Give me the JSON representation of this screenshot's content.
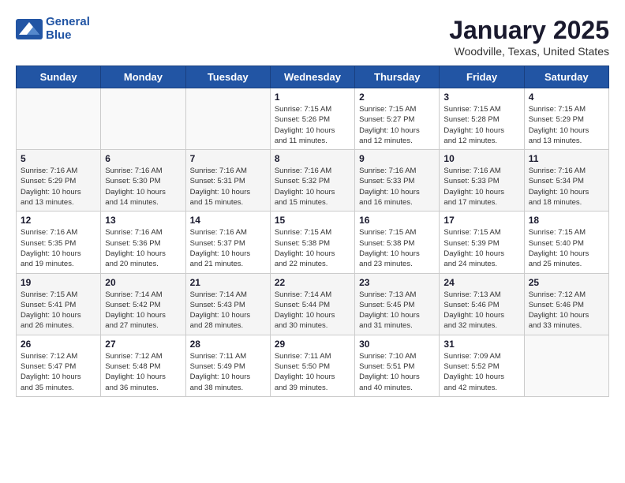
{
  "header": {
    "logo_line1": "General",
    "logo_line2": "Blue",
    "title": "January 2025",
    "subtitle": "Woodville, Texas, United States"
  },
  "weekdays": [
    "Sunday",
    "Monday",
    "Tuesday",
    "Wednesday",
    "Thursday",
    "Friday",
    "Saturday"
  ],
  "weeks": [
    [
      {
        "day": "",
        "info": ""
      },
      {
        "day": "",
        "info": ""
      },
      {
        "day": "",
        "info": ""
      },
      {
        "day": "1",
        "info": "Sunrise: 7:15 AM\nSunset: 5:26 PM\nDaylight: 10 hours\nand 11 minutes."
      },
      {
        "day": "2",
        "info": "Sunrise: 7:15 AM\nSunset: 5:27 PM\nDaylight: 10 hours\nand 12 minutes."
      },
      {
        "day": "3",
        "info": "Sunrise: 7:15 AM\nSunset: 5:28 PM\nDaylight: 10 hours\nand 12 minutes."
      },
      {
        "day": "4",
        "info": "Sunrise: 7:15 AM\nSunset: 5:29 PM\nDaylight: 10 hours\nand 13 minutes."
      }
    ],
    [
      {
        "day": "5",
        "info": "Sunrise: 7:16 AM\nSunset: 5:29 PM\nDaylight: 10 hours\nand 13 minutes."
      },
      {
        "day": "6",
        "info": "Sunrise: 7:16 AM\nSunset: 5:30 PM\nDaylight: 10 hours\nand 14 minutes."
      },
      {
        "day": "7",
        "info": "Sunrise: 7:16 AM\nSunset: 5:31 PM\nDaylight: 10 hours\nand 15 minutes."
      },
      {
        "day": "8",
        "info": "Sunrise: 7:16 AM\nSunset: 5:32 PM\nDaylight: 10 hours\nand 15 minutes."
      },
      {
        "day": "9",
        "info": "Sunrise: 7:16 AM\nSunset: 5:33 PM\nDaylight: 10 hours\nand 16 minutes."
      },
      {
        "day": "10",
        "info": "Sunrise: 7:16 AM\nSunset: 5:33 PM\nDaylight: 10 hours\nand 17 minutes."
      },
      {
        "day": "11",
        "info": "Sunrise: 7:16 AM\nSunset: 5:34 PM\nDaylight: 10 hours\nand 18 minutes."
      }
    ],
    [
      {
        "day": "12",
        "info": "Sunrise: 7:16 AM\nSunset: 5:35 PM\nDaylight: 10 hours\nand 19 minutes."
      },
      {
        "day": "13",
        "info": "Sunrise: 7:16 AM\nSunset: 5:36 PM\nDaylight: 10 hours\nand 20 minutes."
      },
      {
        "day": "14",
        "info": "Sunrise: 7:16 AM\nSunset: 5:37 PM\nDaylight: 10 hours\nand 21 minutes."
      },
      {
        "day": "15",
        "info": "Sunrise: 7:15 AM\nSunset: 5:38 PM\nDaylight: 10 hours\nand 22 minutes."
      },
      {
        "day": "16",
        "info": "Sunrise: 7:15 AM\nSunset: 5:38 PM\nDaylight: 10 hours\nand 23 minutes."
      },
      {
        "day": "17",
        "info": "Sunrise: 7:15 AM\nSunset: 5:39 PM\nDaylight: 10 hours\nand 24 minutes."
      },
      {
        "day": "18",
        "info": "Sunrise: 7:15 AM\nSunset: 5:40 PM\nDaylight: 10 hours\nand 25 minutes."
      }
    ],
    [
      {
        "day": "19",
        "info": "Sunrise: 7:15 AM\nSunset: 5:41 PM\nDaylight: 10 hours\nand 26 minutes."
      },
      {
        "day": "20",
        "info": "Sunrise: 7:14 AM\nSunset: 5:42 PM\nDaylight: 10 hours\nand 27 minutes."
      },
      {
        "day": "21",
        "info": "Sunrise: 7:14 AM\nSunset: 5:43 PM\nDaylight: 10 hours\nand 28 minutes."
      },
      {
        "day": "22",
        "info": "Sunrise: 7:14 AM\nSunset: 5:44 PM\nDaylight: 10 hours\nand 30 minutes."
      },
      {
        "day": "23",
        "info": "Sunrise: 7:13 AM\nSunset: 5:45 PM\nDaylight: 10 hours\nand 31 minutes."
      },
      {
        "day": "24",
        "info": "Sunrise: 7:13 AM\nSunset: 5:46 PM\nDaylight: 10 hours\nand 32 minutes."
      },
      {
        "day": "25",
        "info": "Sunrise: 7:12 AM\nSunset: 5:46 PM\nDaylight: 10 hours\nand 33 minutes."
      }
    ],
    [
      {
        "day": "26",
        "info": "Sunrise: 7:12 AM\nSunset: 5:47 PM\nDaylight: 10 hours\nand 35 minutes."
      },
      {
        "day": "27",
        "info": "Sunrise: 7:12 AM\nSunset: 5:48 PM\nDaylight: 10 hours\nand 36 minutes."
      },
      {
        "day": "28",
        "info": "Sunrise: 7:11 AM\nSunset: 5:49 PM\nDaylight: 10 hours\nand 38 minutes."
      },
      {
        "day": "29",
        "info": "Sunrise: 7:11 AM\nSunset: 5:50 PM\nDaylight: 10 hours\nand 39 minutes."
      },
      {
        "day": "30",
        "info": "Sunrise: 7:10 AM\nSunset: 5:51 PM\nDaylight: 10 hours\nand 40 minutes."
      },
      {
        "day": "31",
        "info": "Sunrise: 7:09 AM\nSunset: 5:52 PM\nDaylight: 10 hours\nand 42 minutes."
      },
      {
        "day": "",
        "info": ""
      }
    ]
  ]
}
